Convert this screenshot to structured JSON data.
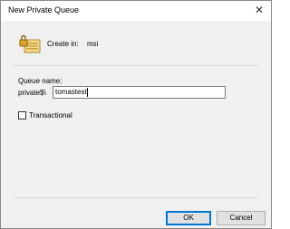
{
  "window": {
    "title": "New Private Queue",
    "close_symbol": "✕"
  },
  "header": {
    "icon": "private-queue-icon",
    "create_in_label": "Create in:",
    "create_in_value": "msi"
  },
  "form": {
    "queue_name_label": "Queue name:",
    "prefix": "private$\\",
    "queue_name_value": "tomastest"
  },
  "options": {
    "transactional_label": "Transactional",
    "transactional_checked": false
  },
  "buttons": {
    "ok": "OK",
    "cancel": "Cancel"
  }
}
